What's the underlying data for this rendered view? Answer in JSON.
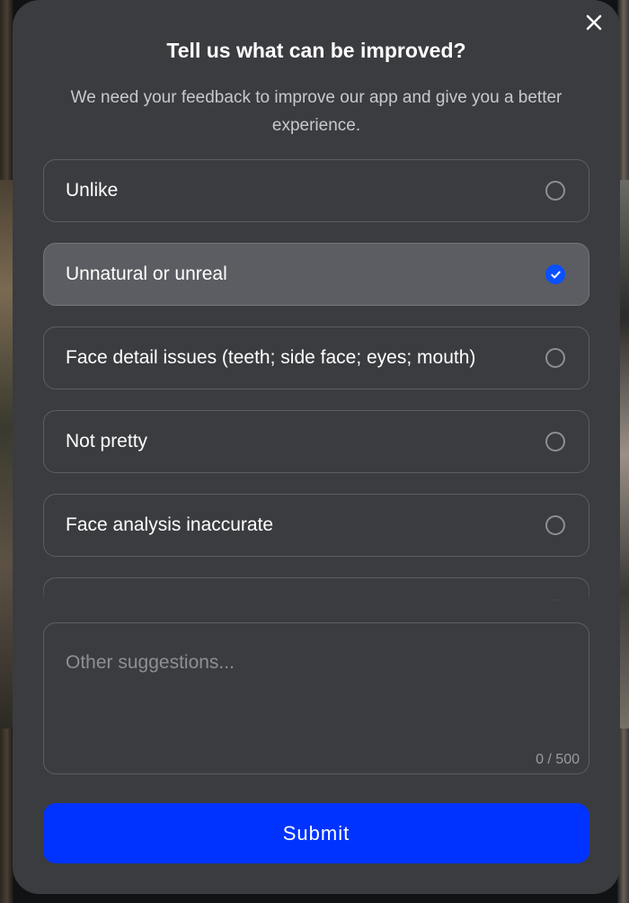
{
  "modal": {
    "title": "Tell us what can be improved?",
    "subtitle": "We need your feedback to improve our app and give you a better experience."
  },
  "options": [
    {
      "label": "Unlike",
      "selected": false
    },
    {
      "label": "Unnatural or unreal",
      "selected": true
    },
    {
      "label": "Face detail issues (teeth; side face; eyes; mouth)",
      "selected": false
    },
    {
      "label": "Not pretty",
      "selected": false
    },
    {
      "label": "Face analysis inaccurate",
      "selected": false
    },
    {
      "label": "",
      "selected": false
    }
  ],
  "suggestions": {
    "placeholder": "Other suggestions...",
    "value": "",
    "counter": "0 / 500"
  },
  "submit_label": "Submit",
  "icons": {
    "close": "close-icon",
    "check": "check-icon"
  },
  "colors": {
    "accent": "#0033ff",
    "check": "#0a50ff",
    "modal_bg": "#3b3c40",
    "selected_bg": "#5c5d62"
  }
}
